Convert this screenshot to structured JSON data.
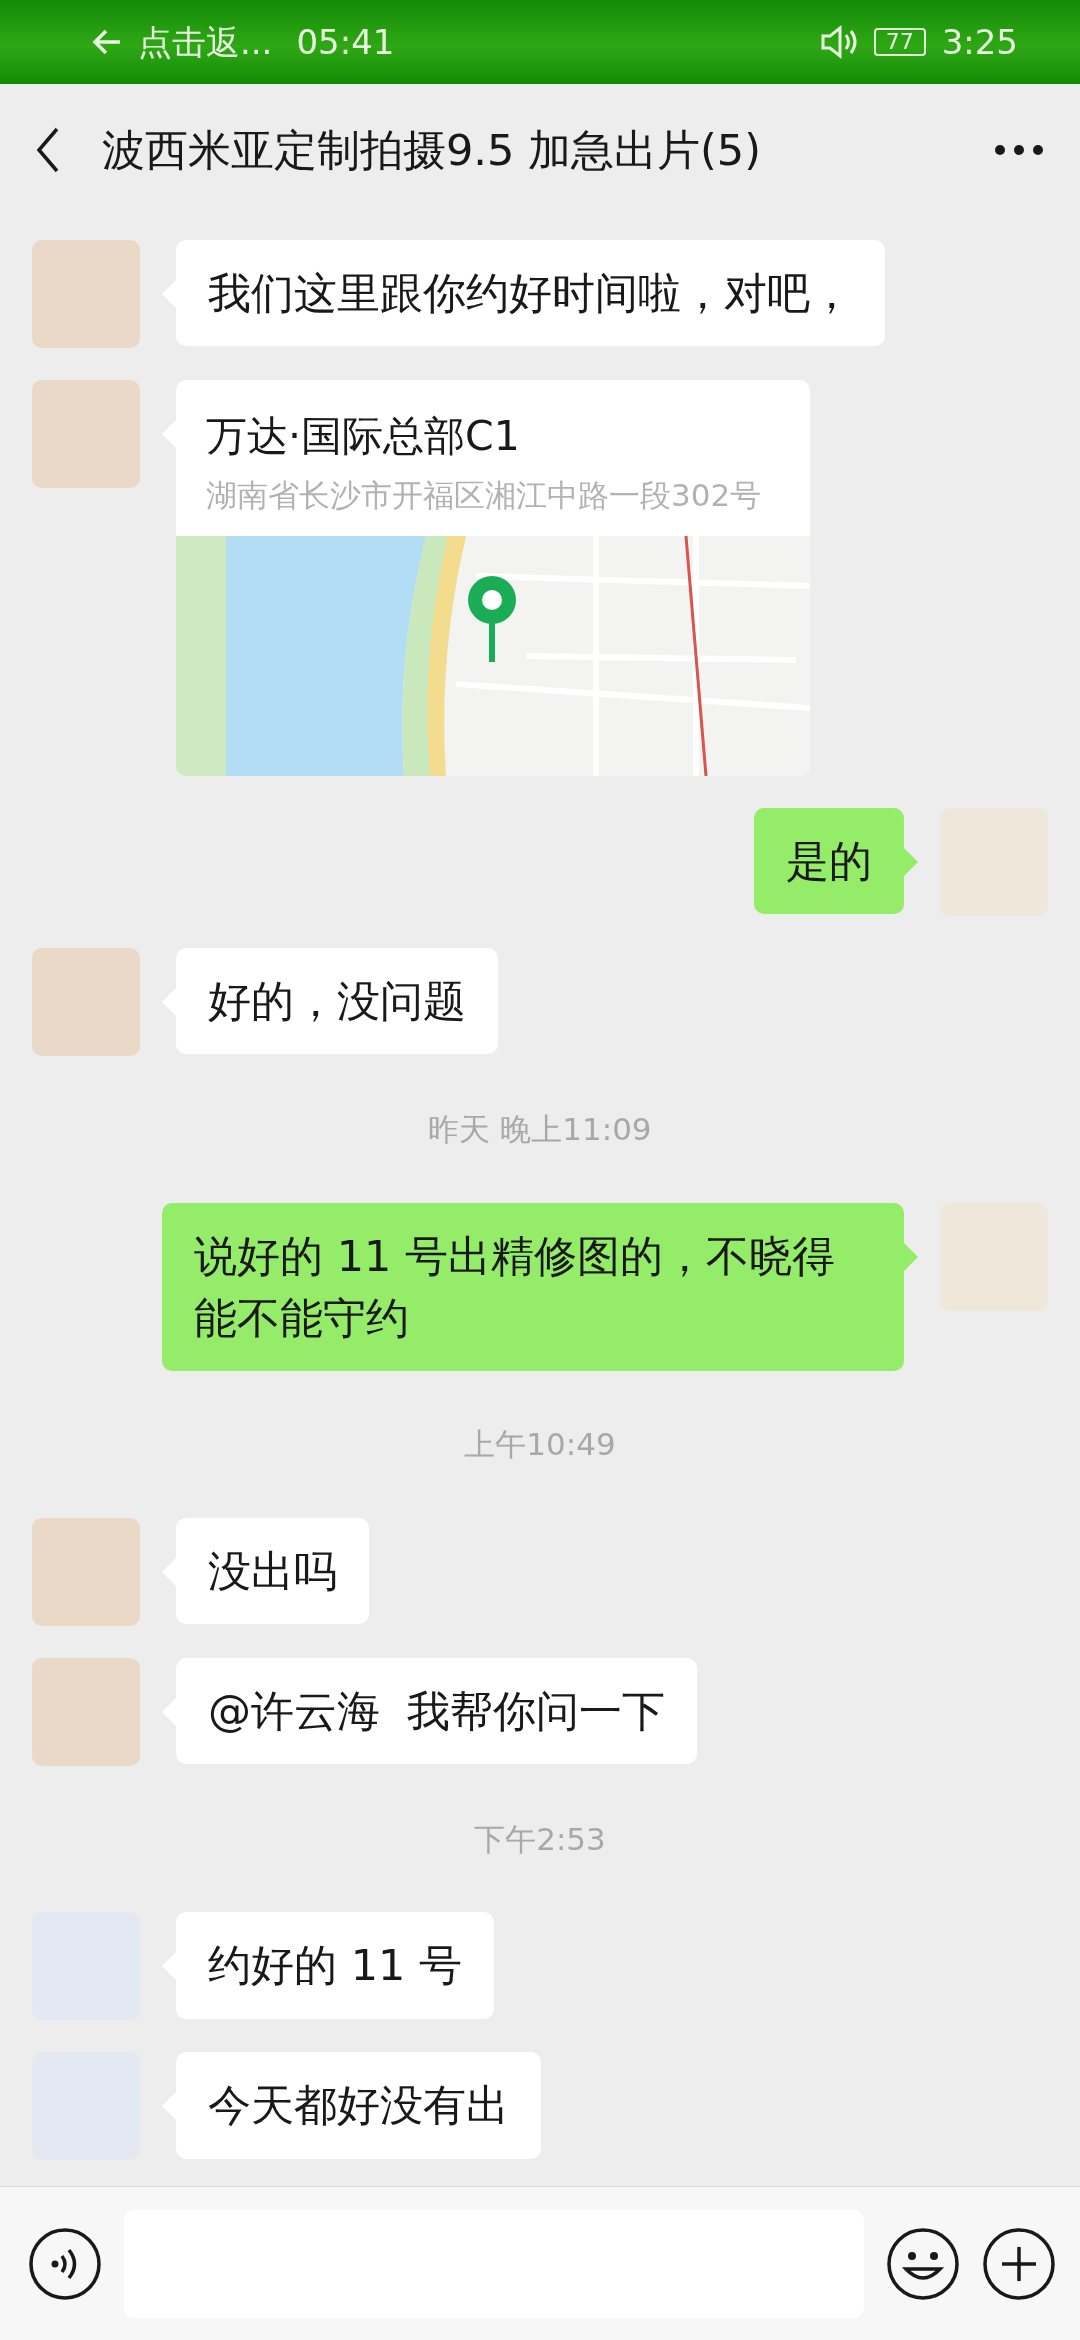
{
  "status_bar": {
    "back_label": "点击返...",
    "clock_left": "05:41",
    "battery": "77",
    "clock": "3:25"
  },
  "header": {
    "title": "波西米亚定制拍摄9.5 加急出片(5)"
  },
  "messages": [
    {
      "kind": "text",
      "outgoing": false,
      "color": "#e9d9c6",
      "text": "我们这里跟你约好时间啦，对吧，"
    },
    {
      "kind": "location",
      "outgoing": false,
      "color": "#e9d9c6",
      "name": "万达·国际总部C1",
      "address": "湖南省长沙市开福区湘江中路一段302号"
    },
    {
      "kind": "text",
      "outgoing": true,
      "color": "#efe7d9",
      "text": "是的"
    },
    {
      "kind": "text",
      "outgoing": false,
      "color": "#e9d9c6",
      "text": "好的，没问题"
    },
    {
      "kind": "time",
      "text": "昨天 晚上11:09"
    },
    {
      "kind": "text",
      "outgoing": true,
      "color": "#efe7d9",
      "text": "说好的 11 号出精修图的，不晓得能不能守约"
    },
    {
      "kind": "time",
      "text": "上午10:49"
    },
    {
      "kind": "text",
      "outgoing": false,
      "color": "#e9d9c6",
      "text": "没出吗"
    },
    {
      "kind": "text",
      "outgoing": false,
      "color": "#e9d9c6",
      "text": "@许云海  我帮你问一下"
    },
    {
      "kind": "time",
      "text": "下午2:53"
    },
    {
      "kind": "text",
      "outgoing": false,
      "color": "#e4e8f3",
      "text": "约好的 11 号"
    },
    {
      "kind": "text",
      "outgoing": false,
      "color": "#e4e8f3",
      "text": "今天都好没有出"
    }
  ]
}
